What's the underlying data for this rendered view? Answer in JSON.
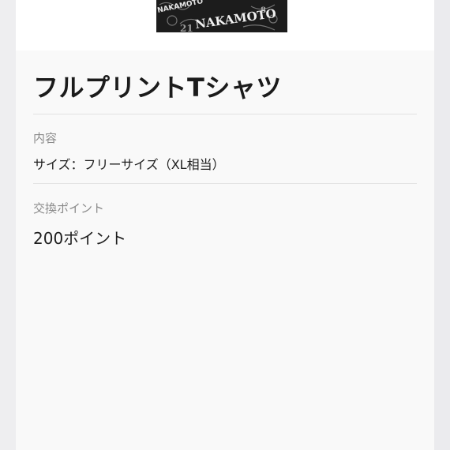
{
  "product": {
    "image_alt": "full-print-tshirt-image",
    "print_text": "NAKAMOTO",
    "title": "フルプリントTシャツ"
  },
  "details": {
    "contents_label": "内容",
    "contents_value": "サイズ：フリーサイズ（XL相当）",
    "points_label": "交換ポイント",
    "points_value": "200ポイント"
  }
}
